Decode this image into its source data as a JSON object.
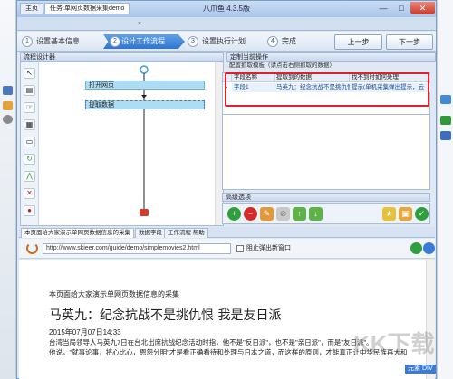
{
  "window": {
    "title": "八爪鱼 4.3.5版",
    "min": "—",
    "max": "□",
    "close": "✕"
  },
  "tabs": {
    "home": "主页",
    "task": "任务:单网页数据采集demo",
    "close": "×"
  },
  "wizard": {
    "steps": [
      {
        "num": "1",
        "label": "设置基本信息"
      },
      {
        "num": "2",
        "label": "设计工作流程"
      },
      {
        "num": "3",
        "label": "设置执行计划"
      },
      {
        "num": "4",
        "label": "完成"
      }
    ],
    "prev": "上一步",
    "next": "下一步"
  },
  "flow": {
    "title": "流程设计器",
    "nodes": [
      "打开网页",
      "提取数据"
    ]
  },
  "settings": {
    "title": "定制当前操作",
    "subtitle": "配置抓取模板（请点击右侧抓取的数据）",
    "columns": [
      "字段名称",
      "提取到的数据",
      "找不到时如何处理"
    ],
    "row": {
      "field": "字段1",
      "data": "马英九：纪念抗战不是挑仇恨",
      "fallback": "提示(单机采集弹出提示，云"
    },
    "advanced": "高级选项"
  },
  "browser": {
    "tabs": [
      "本页面给大家演示单网页数据信息的采集",
      "数据字段",
      "工作流程 帮助"
    ],
    "url": "http://www.skieer.com/guide/demo/simplemovies2.html",
    "block_popup": "阻止弹出新窗口",
    "page": {
      "heading": "本页面给大家演示单网页数据信息的采集",
      "title": "马英九：纪念抗战不是挑仇恨 我是友日派",
      "date": "2015年07月07日14:33",
      "p1": "台湾当局领导人马英九7日在台北出席抗战纪念活动时指，他不是\"反日派\"，也不是\"亲日派\"，而是\"友日派\"。",
      "p2": "他说，\"就事论事，将心比心，恩怨分明\"才是看正确看待和处理与日本之道，而这样的原则，才能真正让中华民族再大和"
    }
  },
  "watermark": "KK下载",
  "download_label": "元素 DIV",
  "colors": {
    "accent": "#2f75cf",
    "highlight": "#e0202a"
  }
}
